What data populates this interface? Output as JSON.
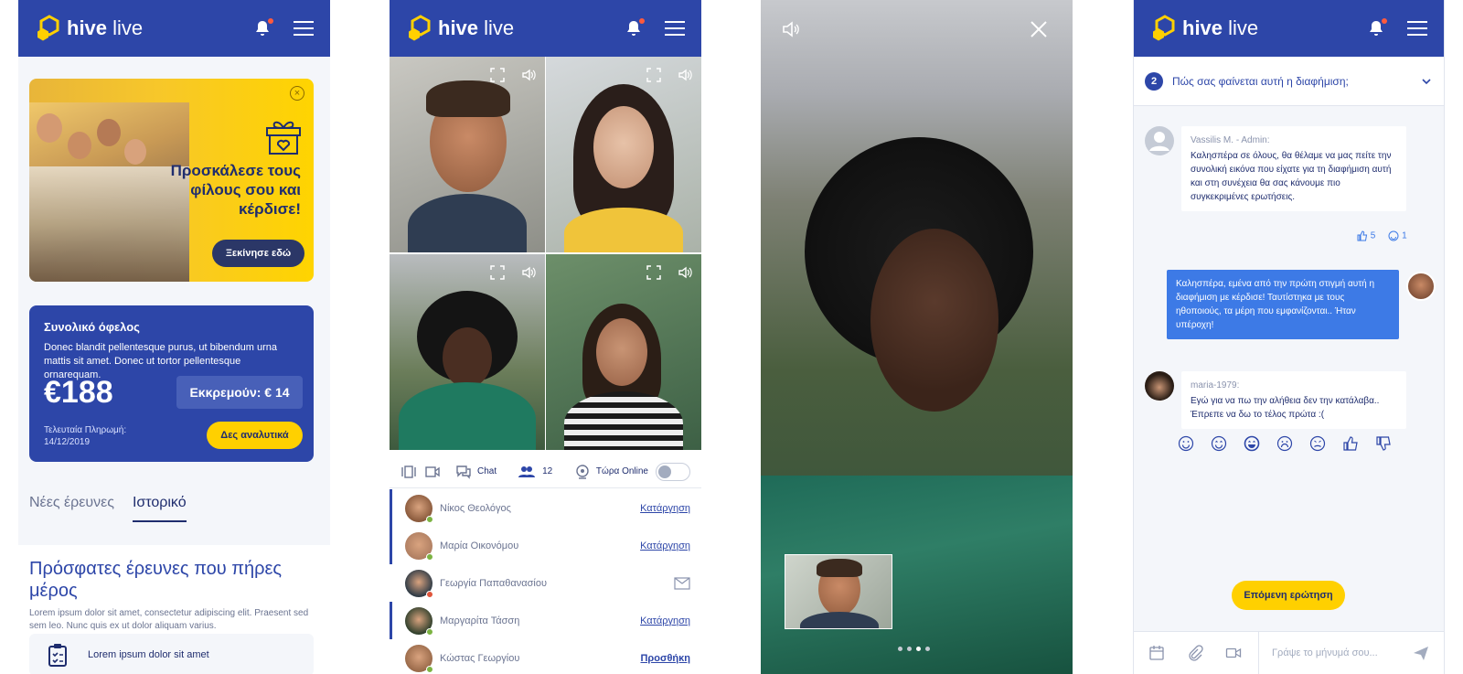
{
  "brand": {
    "name_bold": "hive",
    "name_light": " live"
  },
  "screen1": {
    "promo": {
      "title": "Προσκάλεσε τους φίλους σου και κέρδισε!",
      "cta": "Ξεκίνησε εδώ",
      "close_glyph": "×"
    },
    "benefit": {
      "title": "Συνολικό όφελος",
      "desc": "Donec blandit pellentesque purus, ut bibendum urna mattis sit amet. Donec ut tortor pellentesque ornarequam.",
      "amount": "€188",
      "pending": "Εκκρεμούν: € 14",
      "last_payment_label": "Τελευταία Πληρωμή:",
      "last_payment_date": "14/12/2019",
      "details": "Δες αναλυτικά"
    },
    "tabs": [
      "Νέες έρευνες",
      "Ιστορικό"
    ],
    "recent": {
      "title": "Πρόσφατες έρευνες που πήρες μέρος",
      "desc": "Lorem ipsum dolor sit amet, consectetur adipiscing elit. Praesent sed sem leo. Nunc quis ex ut dolor aliquam varius.",
      "item": "Lorem ipsum dolor sit amet"
    }
  },
  "screen2": {
    "chat_label": "Chat",
    "participants_count": "12",
    "online_label": "Τώρα Online",
    "participants": [
      {
        "name": "Νίκος Θεολόγος",
        "action": "Κατάργηση",
        "status": "#7cb342",
        "avatar": "#8a5a3c",
        "selected": true
      },
      {
        "name": "Μαρία Οικονόμου",
        "action": "Κατάργηση",
        "status": "#7cb342",
        "avatar": "#b07f62",
        "selected": true
      },
      {
        "name": "Γεωργία Παπαθανασίου",
        "action": "",
        "status": "#e0553b",
        "avatar": "#2f3b46",
        "selected": false
      },
      {
        "name": "Μαργαρίτα Τάσση",
        "action": "Κατάργηση",
        "status": "#7cb342",
        "avatar": "#30402c",
        "selected": true
      },
      {
        "name": "Κώστας Γεωργίου",
        "action": "Προσθήκη",
        "status": "#7cb342",
        "avatar": "#9a6a4a",
        "selected": false
      }
    ]
  },
  "screen4": {
    "question_number": "2",
    "question": "Πώς σας φαίνεται αυτή η διαφήμιση;",
    "admin_name": "Vassilis M. - Admin:",
    "admin_msg": "Καλησπέρα σε όλους, θα θέλαμε να μας πείτε την συνολική εικόνα που είχατε  για τη διαφήμιση αυτή και στη συνέχεια θα σας κάνουμε πιο συγκεκριμένες ερωτήσεις.",
    "likes": "5",
    "smiles": "1",
    "my_msg": "Καλησπέρα, εμένα από την πρώτη στιγμή αυτή η διαφήμιση με κέρδισε! Ταυτίστηκα με τους ηθοποιούς, τα μέρη που εμφανίζονται.. Ήταν υπέροχη!",
    "user_name": "maria-1979:",
    "user_msg": "Εγώ για να πω την αλήθεια δεν την κατάλαβα.. Έπρεπε να δω το τέλος πρώτα :(",
    "next": "Επόμενη ερώτηση",
    "composer_placeholder": "Γράψε το μήνυμά σου..."
  },
  "colors": {
    "brand_blue": "#2d46a8",
    "accent_yellow": "#ffd000",
    "bubble_blue": "#3d7ae6"
  }
}
